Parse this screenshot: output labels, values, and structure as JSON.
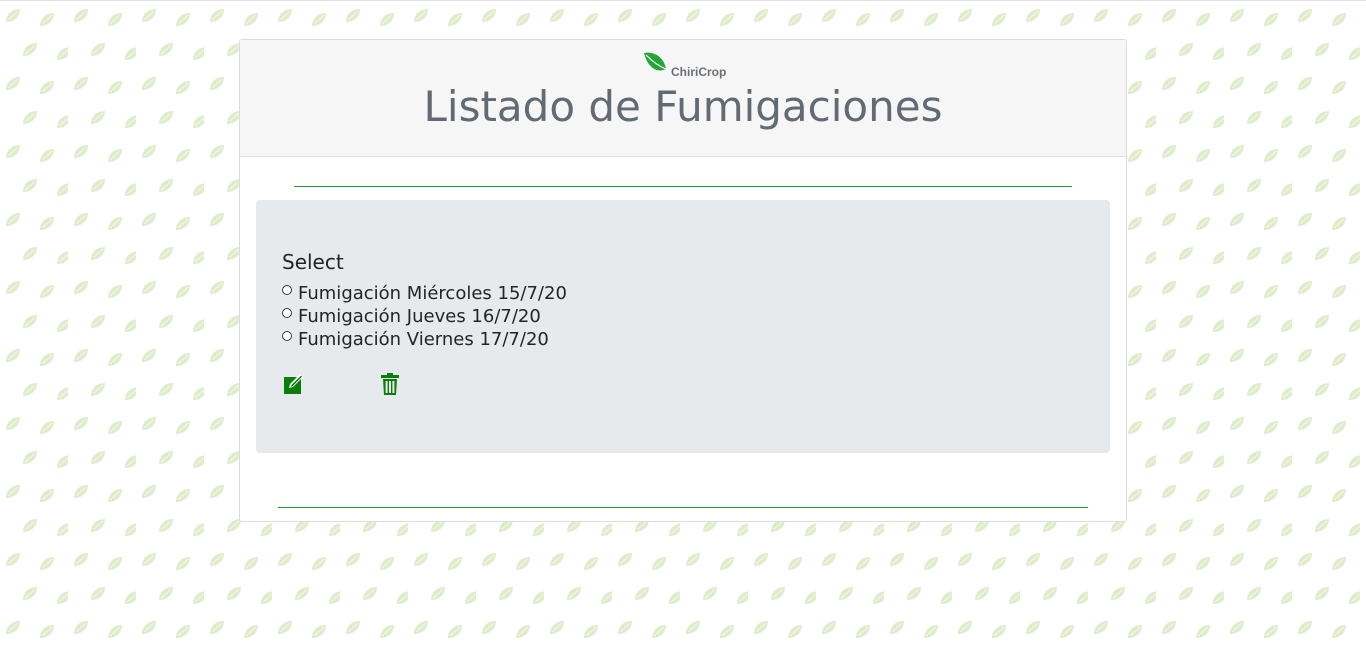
{
  "brand": {
    "name": "ChiriCrop",
    "accent_color": "#1f9a3a",
    "icon": "leaf-icon"
  },
  "page": {
    "title": "Listado de Fumigaciones"
  },
  "form": {
    "select_label": "Select",
    "options": [
      {
        "label": "Fumigación Miércoles 15/7/20",
        "selected": false
      },
      {
        "label": "Fumigación Jueves 16/7/20",
        "selected": false
      },
      {
        "label": "Fumigación Viernes 17/7/20",
        "selected": false
      }
    ],
    "actions": [
      {
        "icon": "edit-icon",
        "color": "#0a7d0a"
      },
      {
        "icon": "trash-icon",
        "color": "#0a7d0a"
      }
    ]
  }
}
